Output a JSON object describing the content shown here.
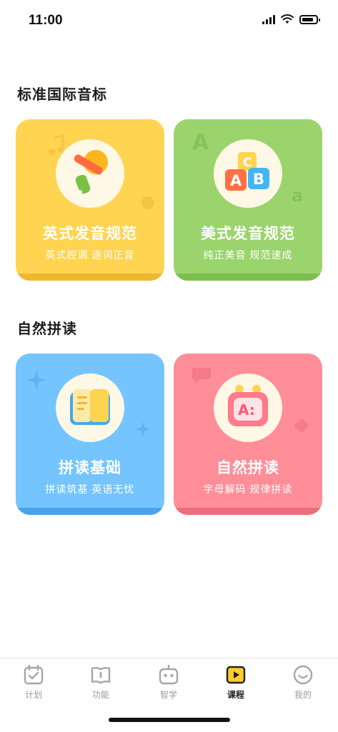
{
  "status_bar": {
    "time": "11:00"
  },
  "sections": [
    {
      "title": "标准国际音标",
      "cards": [
        {
          "title": "英式发音规范",
          "subtitle": "英式腔调 逐词正音",
          "color": "#ffd451",
          "icon": "british-horn-icon"
        },
        {
          "title": "美式发音规范",
          "subtitle": "纯正美音 规范速成",
          "color": "#9bd46c",
          "icon": "abc-blocks-icon"
        }
      ]
    },
    {
      "title": "自然拼读",
      "cards": [
        {
          "title": "拼读基础",
          "subtitle": "拼读筑基 英语无忧",
          "color": "#74c5ff",
          "icon": "open-book-icon"
        },
        {
          "title": "自然拼读",
          "subtitle": "字母解码 规律拼读",
          "color": "#ff8e98",
          "icon": "letter-tv-icon"
        }
      ]
    }
  ],
  "tab_bar": {
    "active": "课程",
    "tabs": [
      {
        "label": "计划",
        "icon": "calendar-check-icon"
      },
      {
        "label": "功能",
        "icon": "book-icon"
      },
      {
        "label": "智学",
        "icon": "robot-icon"
      },
      {
        "label": "课程",
        "icon": "play-icon"
      },
      {
        "label": "我的",
        "icon": "smile-icon"
      }
    ]
  }
}
